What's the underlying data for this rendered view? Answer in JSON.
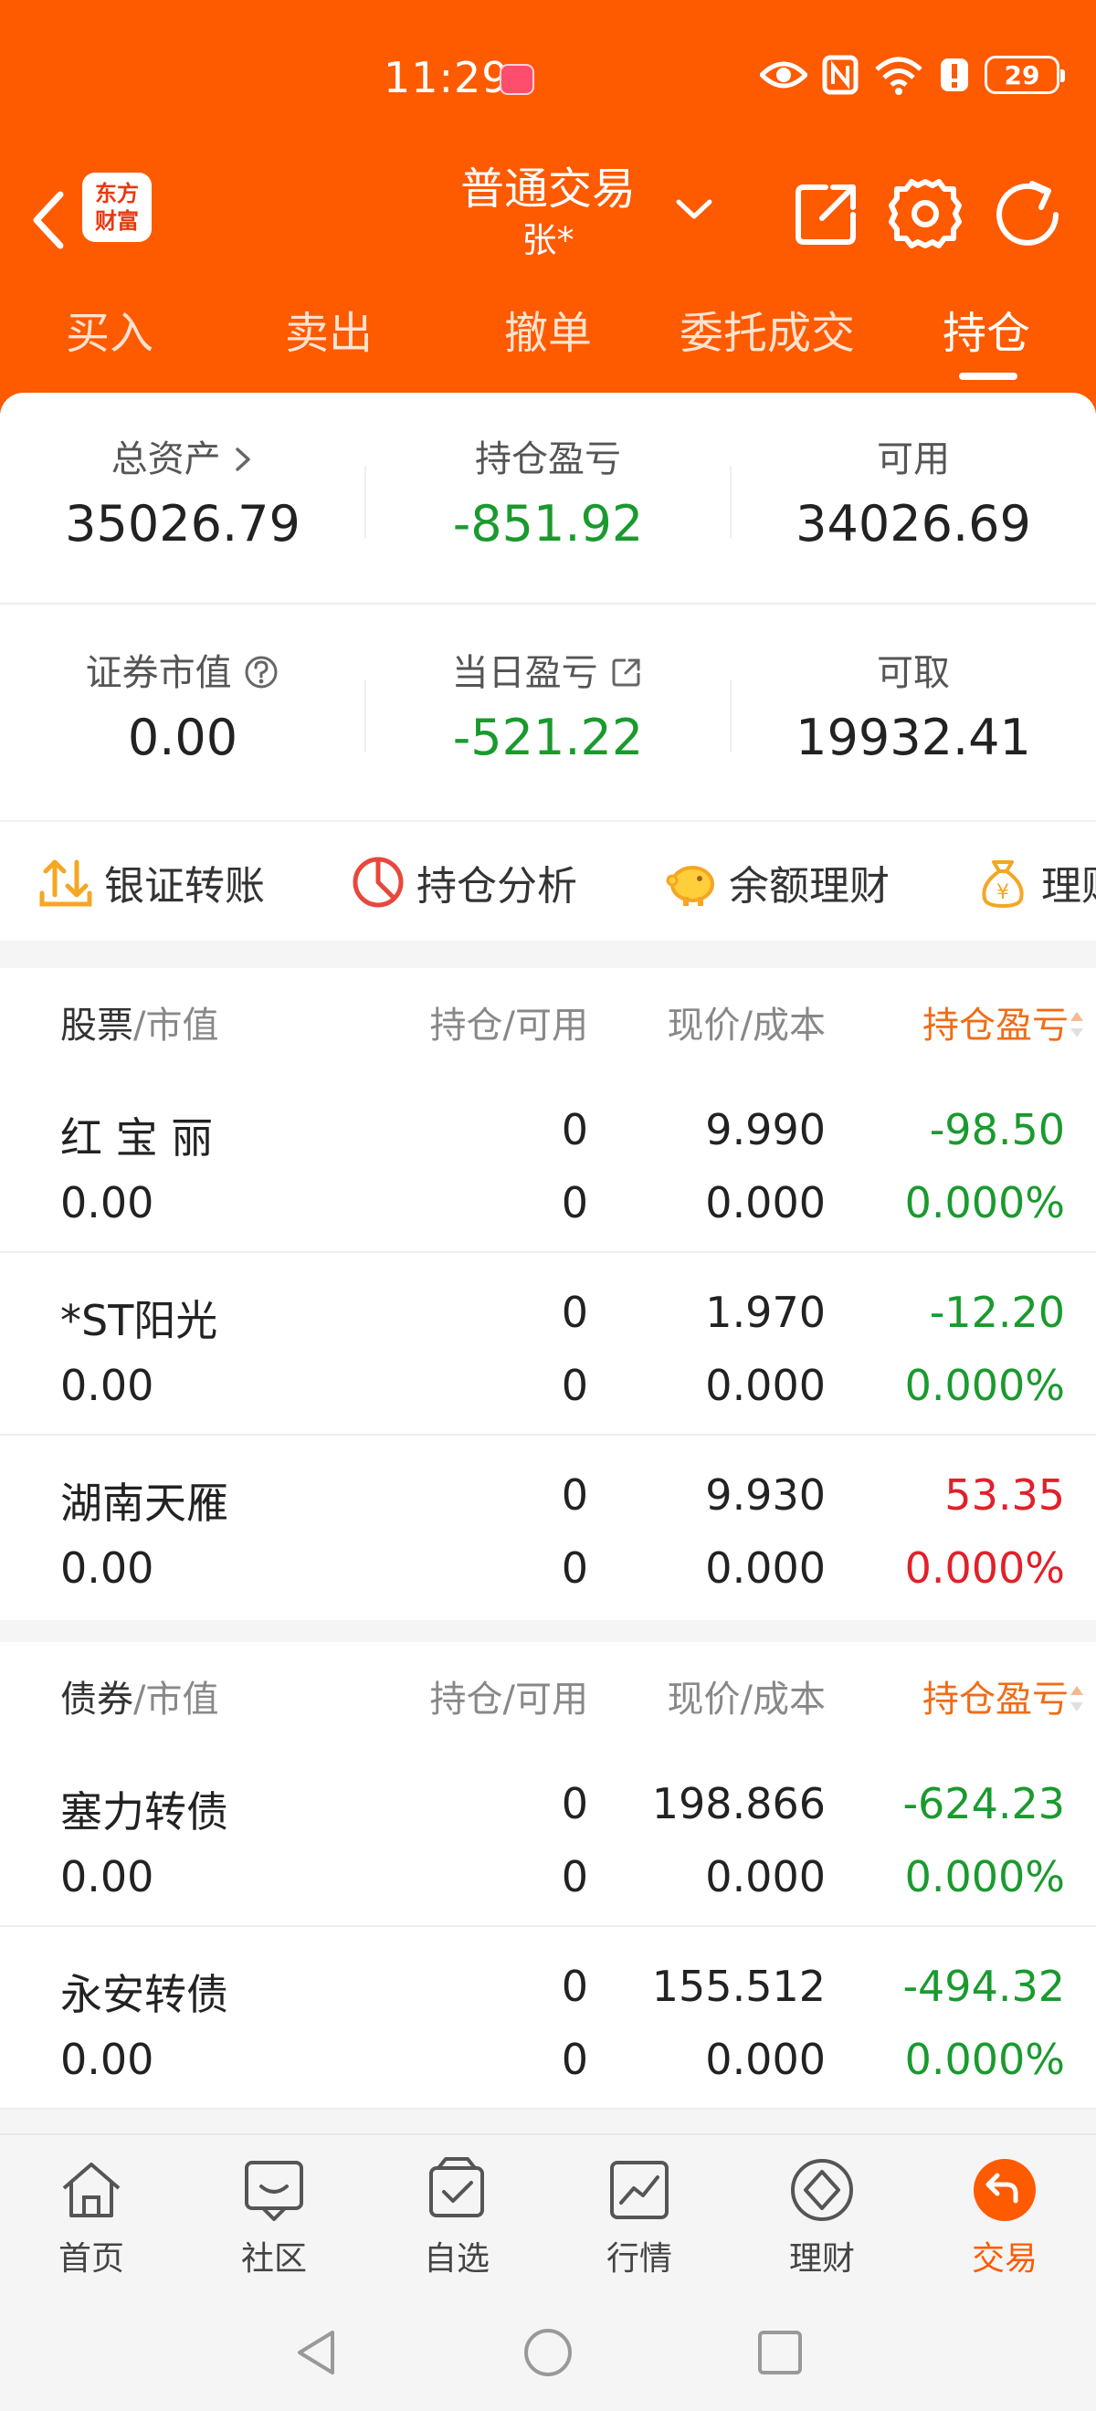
{
  "status_bar": {
    "time": "11:29",
    "battery": "29"
  },
  "header": {
    "logo_line1": "东方",
    "logo_line2": "财富",
    "title": "普通交易",
    "subtitle": "张*"
  },
  "tabs": [
    {
      "label": "买入"
    },
    {
      "label": "卖出"
    },
    {
      "label": "撤单"
    },
    {
      "label": "委托成交"
    },
    {
      "label": "持仓"
    }
  ],
  "summary": {
    "row1": [
      {
        "label": "总资产",
        "value": "35026.79"
      },
      {
        "label": "持仓盈亏",
        "value": "-851.92"
      },
      {
        "label": "可用",
        "value": "34026.69"
      }
    ],
    "row2": [
      {
        "label": "证券市值",
        "value": "0.00"
      },
      {
        "label": "当日盈亏",
        "value": "-521.22"
      },
      {
        "label": "可取",
        "value": "19932.41"
      }
    ]
  },
  "quick_actions": [
    {
      "label": "银证转账"
    },
    {
      "label": "持仓分析"
    },
    {
      "label": "余额理财"
    },
    {
      "label": "理财"
    }
  ],
  "stocks": {
    "header": {
      "name": "股票",
      "sub": "/市值",
      "position": "持仓/可用",
      "price": "现价/成本",
      "pl": "持仓盈亏"
    },
    "rows": [
      {
        "name": "红 宝 丽",
        "value": "0.00",
        "hold": "0",
        "avail": "0",
        "price": "9.990",
        "cost": "0.000",
        "pl": "-98.50",
        "pl_pct": "0.000%"
      },
      {
        "name": "*ST阳光",
        "value": "0.00",
        "hold": "0",
        "avail": "0",
        "price": "1.970",
        "cost": "0.000",
        "pl": "-12.20",
        "pl_pct": "0.000%"
      },
      {
        "name": "湖南天雁",
        "value": "0.00",
        "hold": "0",
        "avail": "0",
        "price": "9.930",
        "cost": "0.000",
        "pl": "53.35",
        "pl_pct": "0.000%"
      }
    ]
  },
  "bonds": {
    "header": {
      "name": "债券",
      "sub": "/市值",
      "position": "持仓/可用",
      "price": "现价/成本",
      "pl": "持仓盈亏"
    },
    "rows": [
      {
        "name": "塞力转债",
        "value": "0.00",
        "hold": "0",
        "avail": "0",
        "price": "198.866",
        "cost": "0.000",
        "pl": "-624.23",
        "pl_pct": "0.000%"
      },
      {
        "name": "永安转债",
        "value": "0.00",
        "hold": "0",
        "avail": "0",
        "price": "155.512",
        "cost": "0.000",
        "pl": "-494.32",
        "pl_pct": "0.000%"
      }
    ]
  },
  "bottom_nav": [
    {
      "label": "首页"
    },
    {
      "label": "社区"
    },
    {
      "label": "自选"
    },
    {
      "label": "行情"
    },
    {
      "label": "理财"
    },
    {
      "label": "交易"
    }
  ],
  "colors": {
    "brand": "#fe5a00",
    "loss": "#1a9a2e",
    "gain": "#e0212a"
  }
}
